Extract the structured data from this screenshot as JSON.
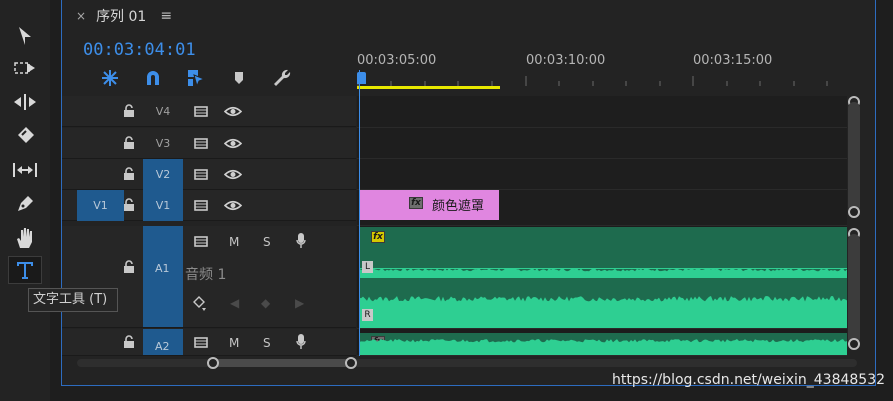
{
  "tools": [
    {
      "name": "selection-tool",
      "icon": "arrow-icon"
    },
    {
      "name": "track-select-tool",
      "icon": "track-select-icon"
    },
    {
      "name": "ripple-edit-tool",
      "icon": "ripple-edit-icon"
    },
    {
      "name": "razor-tool",
      "icon": "razor-icon"
    },
    {
      "name": "slip-tool",
      "icon": "slip-icon"
    },
    {
      "name": "pen-tool",
      "icon": "pen-icon"
    },
    {
      "name": "hand-tool",
      "icon": "hand-icon"
    },
    {
      "name": "type-tool",
      "icon": "type-icon",
      "active": true
    }
  ],
  "tooltip": "文字工具 (T)",
  "panel": {
    "tab_close": "×",
    "tab_title": "序列 01",
    "tab_menu": "≡",
    "timecode": "00:03:04:01",
    "accent": "#3d8ee9"
  },
  "ruler": {
    "labels": [
      "00:03:05:00",
      "00:03:10:00",
      "00:03:15:00"
    ],
    "workarea_color": "#e8e800"
  },
  "video_tracks": [
    {
      "name": "V4",
      "target_on": false,
      "source": ""
    },
    {
      "name": "V3",
      "target_on": false,
      "source": ""
    },
    {
      "name": "V2",
      "target_on": true,
      "source": ""
    },
    {
      "name": "V1",
      "target_on": true,
      "source": "V1"
    }
  ],
  "audio_tracks": [
    {
      "name": "A1",
      "label": "音频 1",
      "mute": "M",
      "solo": "S"
    },
    {
      "name": "A2",
      "mute": "M",
      "solo": "S"
    }
  ],
  "clips": {
    "video_clip_name": "颜色遮罩",
    "video_clip_color": "#e086e0",
    "audio_clip_color": "#1e6b4e",
    "waveform_color": "#2ecf92",
    "fx_badge": "fx",
    "channel_left": "L",
    "channel_right": "R"
  },
  "watermark": "https://blog.csdn.net/weixin_43848532"
}
